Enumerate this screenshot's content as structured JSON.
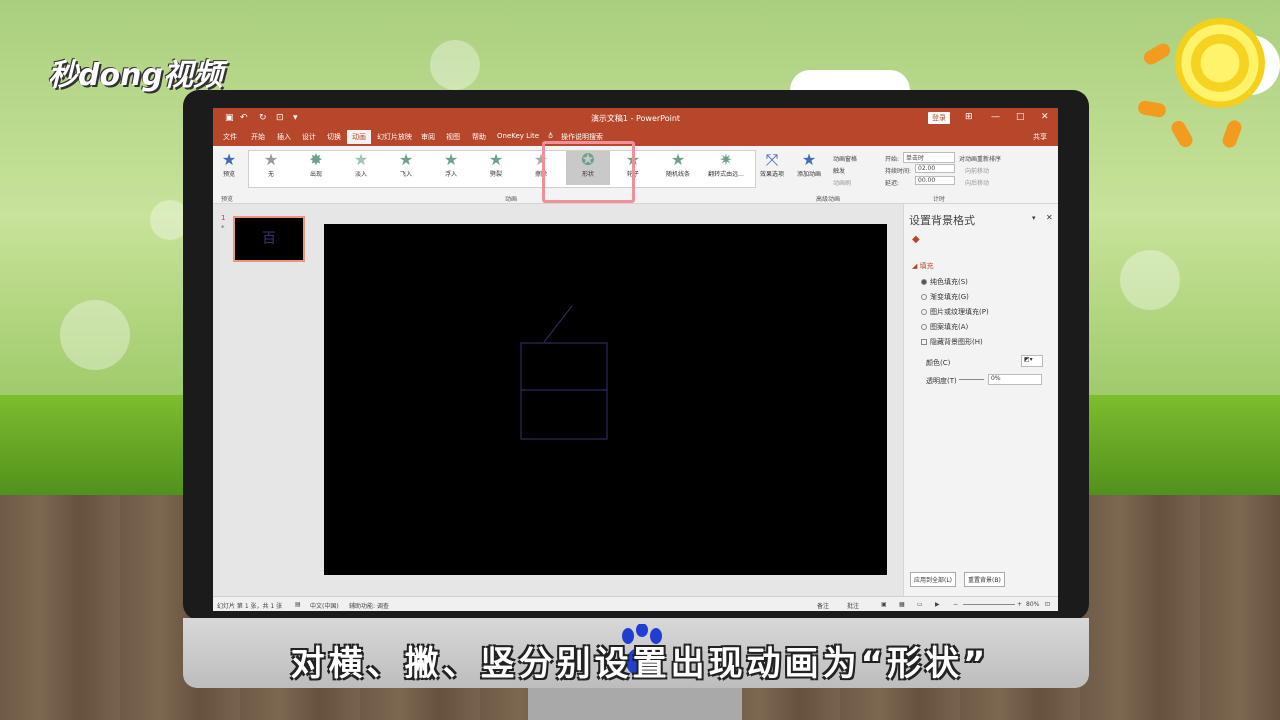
{
  "branding": {
    "logo_text": "秒dong视频"
  },
  "caption": "对横、撇、竖分别设置出现动画为“形状”",
  "window": {
    "title": "演示文稿1 - PowerPoint",
    "login_label": "登录",
    "share_label": "共享"
  },
  "tabs": [
    "文件",
    "开始",
    "插入",
    "设计",
    "切换",
    "动画",
    "幻灯片放映",
    "审阅",
    "视图",
    "帮助",
    "OneKey Lite"
  ],
  "active_tab": "动画",
  "tell_me": "操作说明搜索",
  "ribbon": {
    "preview_label": "预览",
    "preview_group": "预览",
    "animations": [
      "无",
      "出现",
      "淡入",
      "飞入",
      "浮入",
      "劈裂",
      "擦除",
      "形状",
      "轮子",
      "随机线条",
      "翻转式由远..."
    ],
    "selected_animation": "形状",
    "animation_group": "动画",
    "effect_options": "效果选项",
    "add_animation": "添加动画",
    "animation_pane": "动画窗格",
    "trigger": "触发",
    "animation_painter": "动画刷",
    "advanced_group": "高级动画",
    "start_label": "开始:",
    "start_value": "单击时",
    "duration_label": "持续时间:",
    "duration_value": "02.00",
    "delay_label": "延迟:",
    "delay_value": "00.00",
    "reorder_label": "对动画重新排序",
    "move_earlier": "向前移动",
    "move_later": "向后移动",
    "timing_group": "计时"
  },
  "thumbnail": {
    "number": "1",
    "star": "*",
    "glyph": "百"
  },
  "format_panel": {
    "title": "设置背景格式",
    "fill_section": "填充",
    "options": [
      "纯色填充(S)",
      "渐变填充(G)",
      "图片或纹理填充(P)",
      "图案填充(A)"
    ],
    "selected_option": "纯色填充(S)",
    "hide_bg": "隐藏背景图形(H)",
    "color_label": "颜色(C)",
    "transparency_label": "透明度(T)",
    "transparency_value": "0%",
    "apply_all": "应用到全部(L)",
    "reset_bg": "重置背景(B)"
  },
  "status": {
    "slide_info": "幻灯片 第 1 张，共 1 张",
    "language": "中文(中国)",
    "accessibility": "辅助功能: 调查",
    "notes": "备注",
    "comments": "批注",
    "zoom": "80%"
  },
  "colors": {
    "accent": "#b7472a",
    "star": "#6aa38a",
    "stroke": "#35356b"
  }
}
